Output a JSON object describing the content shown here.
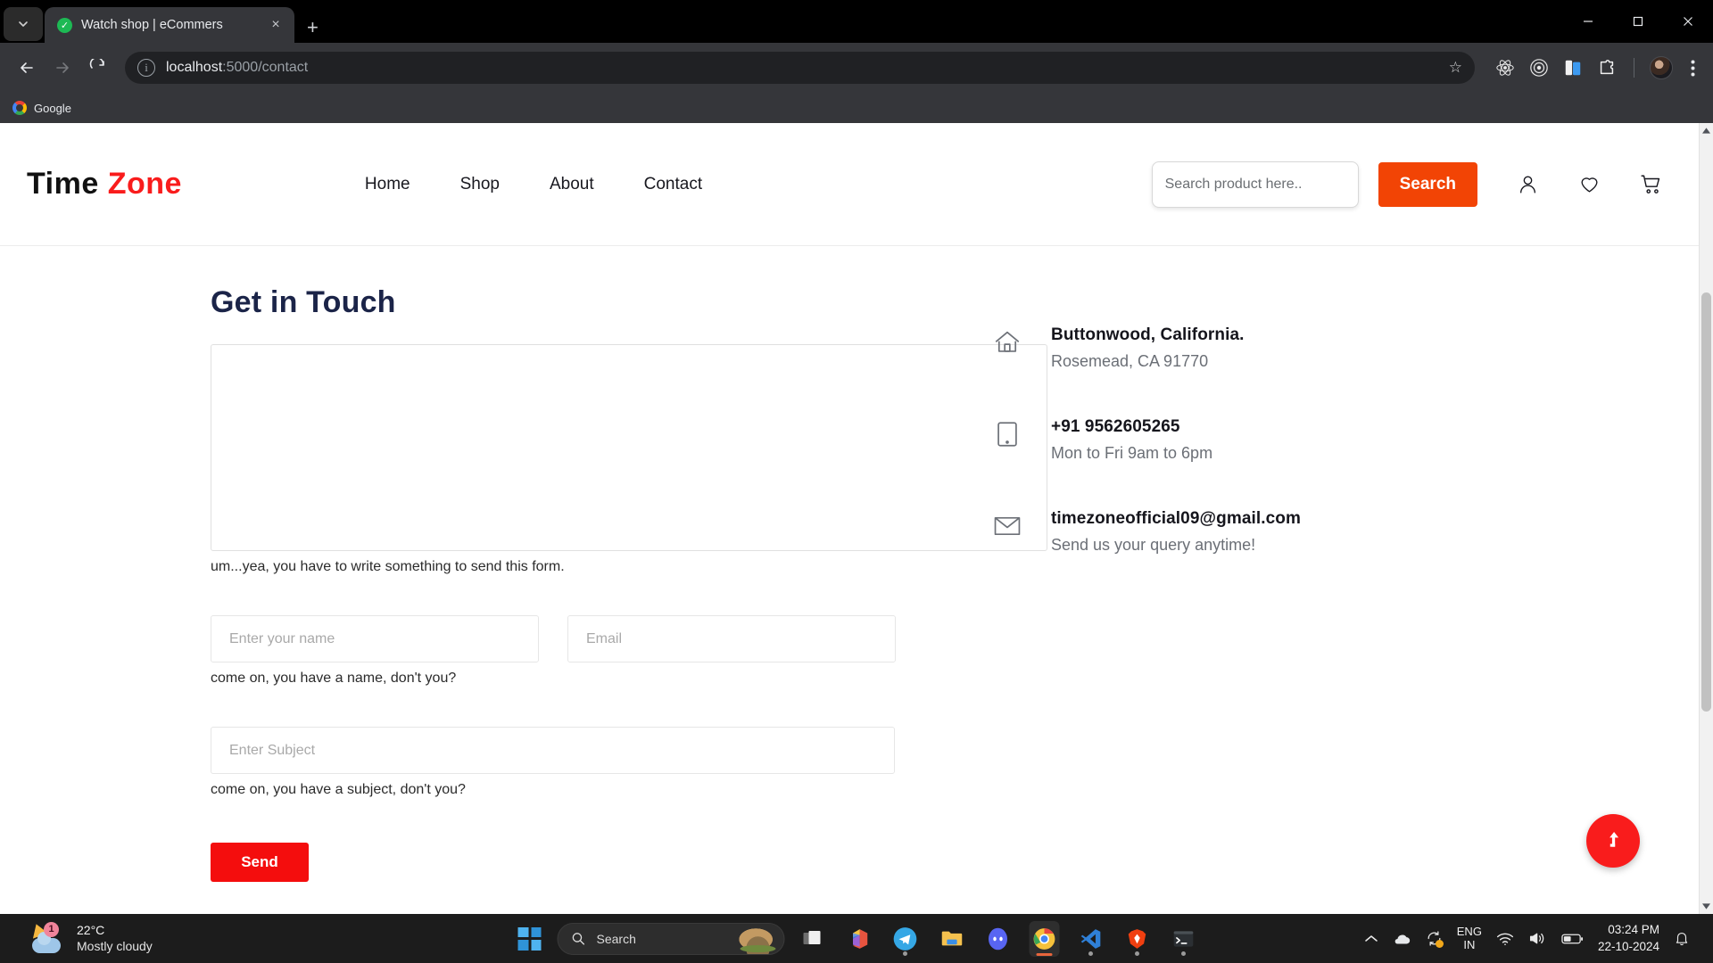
{
  "browser": {
    "tab": {
      "title": "Watch shop | eCommers",
      "favicon": "check-circle-icon",
      "close": "×"
    },
    "newtab_label": "+",
    "chevron_label": "⌄",
    "url": {
      "host": "localhost",
      "path": ":5000/contact"
    },
    "bookmarks": [
      {
        "label": "Google",
        "icon": "google-icon"
      }
    ],
    "extensions": [
      {
        "name": "react-devtools-icon"
      },
      {
        "name": "target-icon"
      },
      {
        "name": "split-view-icon"
      },
      {
        "name": "extensions-puzzle-icon"
      }
    ],
    "window_controls": {
      "minimize": "minimize-icon",
      "maximize": "maximize-icon",
      "close": "close-icon"
    }
  },
  "site": {
    "logo": {
      "first": "Time",
      "second": "Zone",
      "accent_color": "#f91c1c"
    },
    "nav": [
      {
        "label": "Home"
      },
      {
        "label": "Shop"
      },
      {
        "label": "About"
      },
      {
        "label": "Contact"
      }
    ],
    "search": {
      "placeholder": "Search product here..",
      "value": "",
      "button_label": "Search",
      "button_color": "#f24405"
    },
    "header_icons": [
      {
        "name": "user-icon"
      },
      {
        "name": "wishlist-heart-icon"
      },
      {
        "name": "cart-icon"
      }
    ]
  },
  "contact": {
    "title": "Get in Touch",
    "message": {
      "value": "",
      "placeholder": "",
      "error": "um...yea, you have to write something to send this form."
    },
    "name": {
      "placeholder": "Enter your name",
      "value": "",
      "error": "come on, you have a name, don't you?"
    },
    "email": {
      "placeholder": "Email",
      "value": ""
    },
    "subject": {
      "placeholder": "Enter Subject",
      "value": "",
      "error": "come on, you have a subject, don't you?"
    },
    "send_label": "Send",
    "info": [
      {
        "icon": "home-icon",
        "title": "Buttonwood, California.",
        "sub": "Rosemead, CA 91770"
      },
      {
        "icon": "phone-icon",
        "title": "+91 9562605265",
        "sub": "Mon to Fri 9am to 6pm"
      },
      {
        "icon": "envelope-icon",
        "title": "timezoneofficial09@gmail.com",
        "sub": "Send us your query anytime!"
      }
    ],
    "scroll_top": {
      "icon": "arrow-up-icon",
      "color": "#f91c1c"
    }
  },
  "taskbar": {
    "weather": {
      "temperature": "22°C",
      "condition": "Mostly cloudy",
      "badge": "1"
    },
    "search": {
      "placeholder": "Search"
    },
    "apps": [
      {
        "name": "taskview-icon"
      },
      {
        "name": "office-icon"
      },
      {
        "name": "telegram-icon"
      },
      {
        "name": "file-explorer-icon"
      },
      {
        "name": "discord-icon"
      },
      {
        "name": "chrome-icon"
      },
      {
        "name": "vscode-icon"
      },
      {
        "name": "brave-icon"
      },
      {
        "name": "terminal-icon"
      }
    ],
    "tray": {
      "chevron": "⌃",
      "language_top": "ENG",
      "language_bottom": "IN",
      "time": "03:24 PM",
      "date": "22-10-2024"
    }
  }
}
